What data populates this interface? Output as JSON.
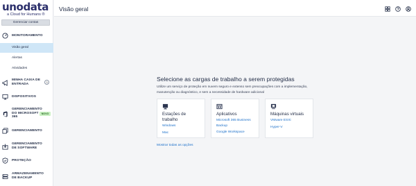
{
  "brand": {
    "name": "unodata",
    "tagline": "a Cloud for Humans ®",
    "manage_accounts": "Gerenciar contas"
  },
  "sidebar": {
    "items": [
      {
        "label": "MONITORAMENTO"
      },
      {
        "label": "Visão geral"
      },
      {
        "label": "Alertas"
      },
      {
        "label": "Atividades"
      },
      {
        "label": "MINHA CAIXA DE ENTRADA",
        "count": "3"
      },
      {
        "label": "DISPOSITIVOS"
      },
      {
        "label": "GERENCIAMENTO DO MICROSOFT 365",
        "badge": "NOVO"
      },
      {
        "label": "GERENCIAMENTO"
      },
      {
        "label": "GERENCIAMENTO DE SOFTWARE"
      },
      {
        "label": "PROTEÇÃO"
      },
      {
        "label": "ARMAZENAMENTO DE BACKUP"
      }
    ]
  },
  "header": {
    "title": "Visão geral",
    "icons": [
      "grid-icon",
      "help-icon",
      "user-icon"
    ]
  },
  "main": {
    "title": "Selecione as cargas de trabalho a serem protegidas",
    "description": "Utilize um serviço de proteção em nuvem seguro e extenso sem preocupações com a implementação, manutenção ou diagnóstico, e sem a necessidade de hardware adicional",
    "cards": [
      {
        "title": "Estações de trabalho",
        "icon": "desktop-icon",
        "links": [
          "Windows",
          "Mac"
        ]
      },
      {
        "title": "Aplicativos",
        "icon": "apps-icon",
        "links": [
          "Microsoft 365 Business Backup",
          "Google Workspace"
        ]
      },
      {
        "title": "Máquinas virtuais",
        "icon": "virtual-machine-icon",
        "links": [
          "VMware ESXi",
          "Hyper-V"
        ]
      }
    ],
    "show_all": "Mostrar todas as opções"
  },
  "colors": {
    "accent": "#1b6fc9",
    "active_bg": "#cfe6f7",
    "brand": "#2b2f6b",
    "badge_bg": "#c9f0c2"
  }
}
